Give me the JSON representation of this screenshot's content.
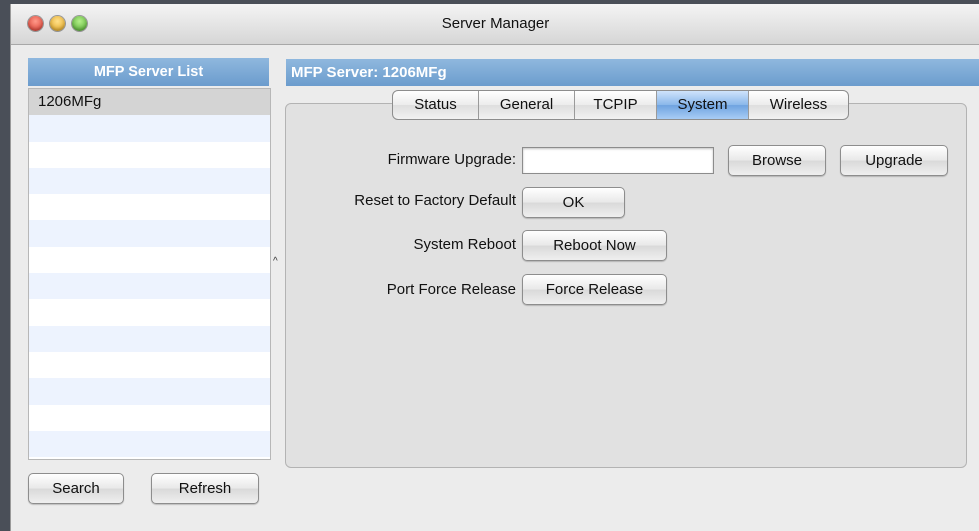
{
  "window": {
    "title": "Server Manager"
  },
  "server_list": {
    "header": "MFP Server List",
    "items": [
      "1206MFg",
      "",
      "",
      "",
      "",
      "",
      "",
      "",
      "",
      "",
      "",
      "",
      "",
      ""
    ]
  },
  "buttons": {
    "search": "Search",
    "refresh": "Refresh"
  },
  "server_panel": {
    "header": "MFP Server: 1206MFg",
    "tabs": [
      "Status",
      "General",
      "TCPIP",
      "System",
      "Wireless"
    ],
    "active_tab": "System"
  },
  "system": {
    "firmware_label": "Firmware Upgrade:",
    "firmware_value": "",
    "browse": "Browse",
    "upgrade": "Upgrade",
    "reset_label": "Reset to Factory Default",
    "ok": "OK",
    "reboot_label": "System Reboot",
    "reboot_now": "Reboot Now",
    "port_label": "Port Force Release",
    "force_release": "Force Release"
  },
  "colors": {
    "header_blue": "#6b9ccd",
    "tab_active": "#8ab7ea"
  }
}
